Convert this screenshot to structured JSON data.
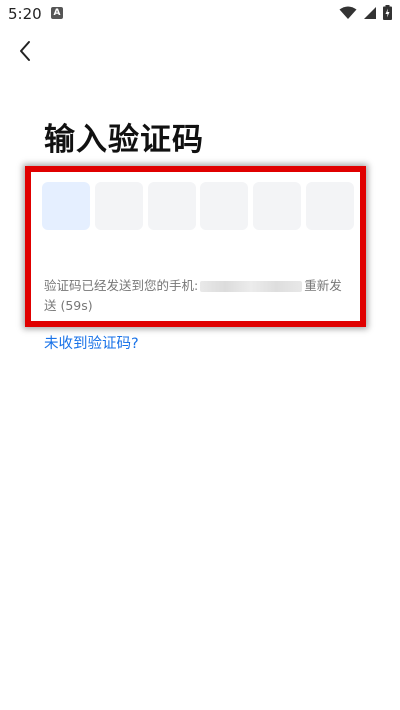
{
  "status_bar": {
    "time": "5:20",
    "notification_glyph": "A"
  },
  "title": "输入验证码",
  "code_cells": [
    "",
    "",
    "",
    "",
    "",
    ""
  ],
  "hint": {
    "prefix": "验证码已经发送到您的手机:",
    "resend_label": "重新发送 (59s)"
  },
  "no_code_link": "未收到验证码?",
  "colors": {
    "accent": "#1a73e8",
    "highlight": "#e00000",
    "cell_bg": "#f3f4f6",
    "cell_active_bg": "#e5efff"
  },
  "icons": [
    "back-arrow-icon",
    "wifi-icon",
    "signal-icon",
    "battery-icon",
    "notification-icon"
  ]
}
